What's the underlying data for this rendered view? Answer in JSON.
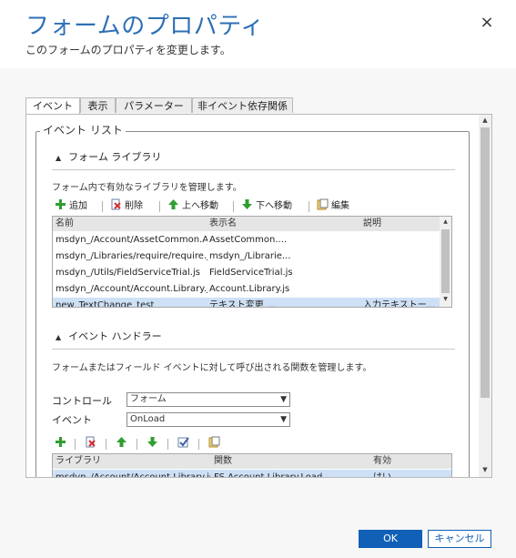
{
  "dialog": {
    "title": "フォームのプロパティ",
    "subtitle": "このフォームのプロパティを変更します。",
    "close_glyph": "×"
  },
  "tabs": [
    {
      "label": "イベント",
      "active": true
    },
    {
      "label": "表示",
      "active": false
    },
    {
      "label": "パラメーター",
      "active": false
    },
    {
      "label": "非イベント依存関係",
      "active": false
    }
  ],
  "event_list": {
    "legend": "イベント リスト",
    "form_library": {
      "title": "フォーム ライブラリ",
      "description": "フォーム内で有効なライブラリを管理します。",
      "toolbar": {
        "add": "追加",
        "remove": "削除",
        "move_up": "上へ移動",
        "move_down": "下へ移動",
        "edit": "編集"
      },
      "columns": [
        "名前",
        "表示名",
        "説明"
      ],
      "rows": [
        {
          "name": "msdyn_/Account/AssetCommon.A...",
          "display": "AssetCommon....",
          "desc": ""
        },
        {
          "name": "msdyn_/Libraries/require/require.js",
          "display": "msdyn_/Librarie...",
          "desc": ""
        },
        {
          "name": "msdyn_/Utils/FieldServiceTrial.js",
          "display": "FieldServiceTrial.js",
          "desc": ""
        },
        {
          "name": "msdyn_/Account/Account.Library.js",
          "display": "Account.Library.js",
          "desc": ""
        },
        {
          "name": "new_TextChange_test",
          "display": "テキスト変更 ...",
          "desc": "入力テキストー..."
        }
      ]
    },
    "event_handlers": {
      "title": "イベント ハンドラー",
      "description": "フォームまたはフィールド イベントに対して呼び出される関数を管理します。",
      "control_label": "コントロール",
      "control_value": "フォーム",
      "event_label": "イベント",
      "event_value": "OnLoad",
      "columns": [
        "ライブラリ",
        "関数",
        "有効"
      ],
      "rows": [
        {
          "library": "msdyn_/Account/Account.Library.js",
          "function": "FS.Account.Library.Load",
          "enabled": "はい"
        }
      ]
    }
  },
  "footer": {
    "ok": "OK",
    "cancel": "キャンセル"
  },
  "colors": {
    "accent": "#1160b7",
    "title": "#2d6fb6",
    "selected_row": "#cde0f5"
  }
}
